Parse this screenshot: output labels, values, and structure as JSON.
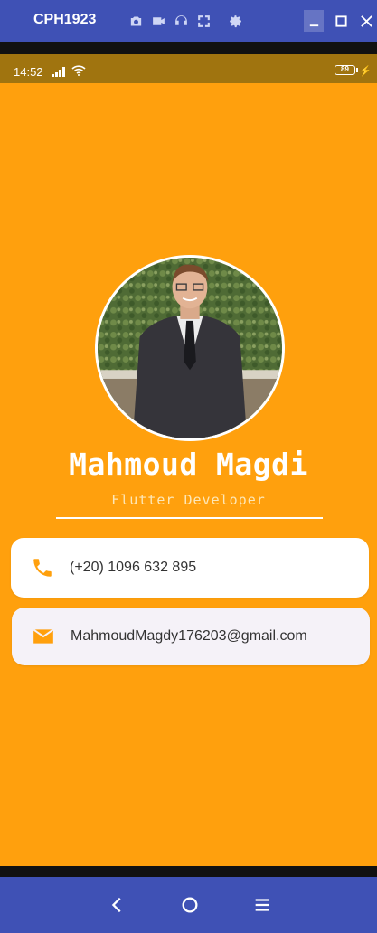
{
  "emulator": {
    "device_name": "CPH1923",
    "toolbar_icons": [
      "camera-icon",
      "video-icon",
      "headset-icon",
      "fullscreen-icon",
      "settings-icon"
    ],
    "window_controls": [
      "minimize-icon",
      "maximize-icon",
      "close-icon"
    ]
  },
  "statusbar": {
    "time": "14:52",
    "battery": "89"
  },
  "profile": {
    "name": "Mahmoud Magdi",
    "role": "Flutter Developer"
  },
  "contacts": {
    "phone": {
      "icon": "phone-icon",
      "text": "(+20) 1096 632 895"
    },
    "email": {
      "icon": "email-icon",
      "text": "MahmoudMagdy176203@gmail.com"
    }
  },
  "navbar": [
    "back-icon",
    "home-icon",
    "menu-icon"
  ],
  "colors": {
    "accent": "#ffa00d",
    "emulator_chrome": "#3f51b5",
    "statusbar": "#a0740f",
    "text": "#ffffff"
  }
}
